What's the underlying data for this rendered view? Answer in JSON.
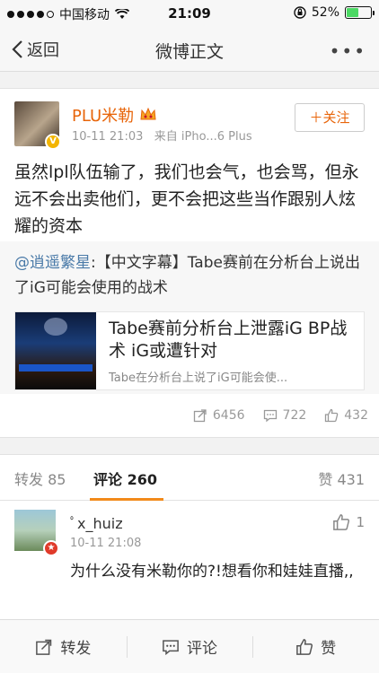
{
  "status_bar": {
    "carrier": "中国移动",
    "time": "21:09",
    "battery": "52%",
    "battery_fraction": 0.52
  },
  "nav": {
    "back_label": "返回",
    "title": "微博正文",
    "more_label": "•••"
  },
  "post": {
    "author": "PLU米勒",
    "time": "10-11 21:03",
    "source": "来自 iPho...6 Plus",
    "follow_label": "关注",
    "text": "虽然lpl队伍输了，我们也会气，也会骂，但永远不会出卖他们，更不会把这些当作跟别人炫耀的资本",
    "repost": {
      "mention": "@逍遥繁星",
      "text": ":【中文字幕】Tabe赛前在分析台上说出了iG可能会使用的战术",
      "link_title": "Tabe赛前分析台上泄露iG BP战术 iG或遭针对",
      "link_desc": "Tabe在分析台上说了iG可能会使..."
    },
    "stats": {
      "reposts": "6456",
      "comments": "722",
      "likes": "432"
    }
  },
  "tabs": {
    "repost_label": "转发",
    "repost_count": "85",
    "comment_label": "评论",
    "comment_count": "260",
    "like_label": "赞",
    "like_count": "431"
  },
  "comment": {
    "name": "ﾟx_huiz",
    "time": "10-11 21:08",
    "likes": "1",
    "text": "为什么没有米勒你的?!想看你和娃娃直播,,"
  },
  "toolbar": {
    "repost": "转发",
    "comment": "评论",
    "like": "赞"
  }
}
